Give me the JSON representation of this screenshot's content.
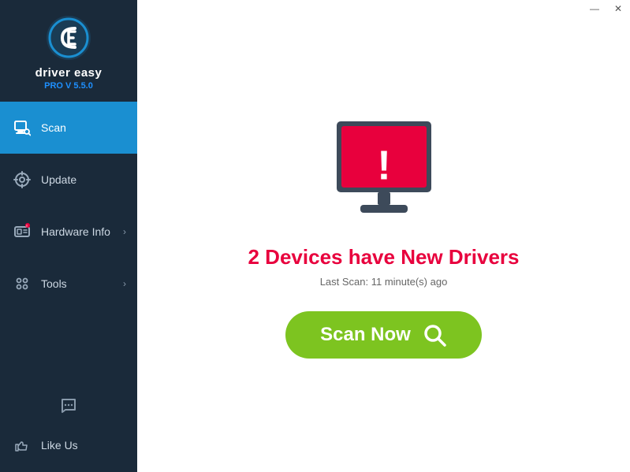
{
  "titlebar": {
    "minimize_label": "—",
    "close_label": "✕"
  },
  "sidebar": {
    "app_name": "driver easy",
    "app_version": "PRO V 5.5.0",
    "nav_items": [
      {
        "id": "scan",
        "label": "Scan",
        "active": true,
        "has_arrow": false
      },
      {
        "id": "update",
        "label": "Update",
        "active": false,
        "has_arrow": false
      },
      {
        "id": "hardware-info",
        "label": "Hardware Info",
        "active": false,
        "has_arrow": true
      },
      {
        "id": "tools",
        "label": "Tools",
        "active": false,
        "has_arrow": true
      }
    ],
    "like_us_label": "Like Us"
  },
  "main": {
    "alert_title": "2 Devices have New Drivers",
    "last_scan_text": "Last Scan: 11 minute(s) ago",
    "scan_now_label": "Scan Now"
  }
}
